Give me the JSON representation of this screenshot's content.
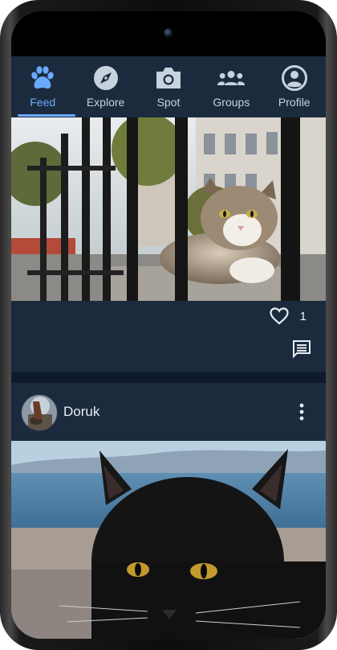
{
  "nav": {
    "items": [
      {
        "label": "Feed",
        "icon": "paw-icon",
        "active": true
      },
      {
        "label": "Explore",
        "icon": "compass-icon"
      },
      {
        "label": "Spot",
        "icon": "camera-icon"
      },
      {
        "label": "Groups",
        "icon": "group-icon"
      },
      {
        "label": "Profile",
        "icon": "person-circle-icon"
      }
    ]
  },
  "posts": [
    {
      "photo": "tabby-cat-behind-iron-fence-photo",
      "likes": "1",
      "actions": [
        "heart-icon",
        "comment-icon"
      ]
    },
    {
      "author": "Doruk",
      "avatar": "cat-avatar",
      "photo": "black-cat-by-sea-photo",
      "menu_icon": "more-vertical-icon"
    }
  ],
  "colors": {
    "accent": "#6aa9ff",
    "nav_bg": "#1b2b3d",
    "app_bg": "#0f1b2a",
    "text": "#e9eef4"
  }
}
